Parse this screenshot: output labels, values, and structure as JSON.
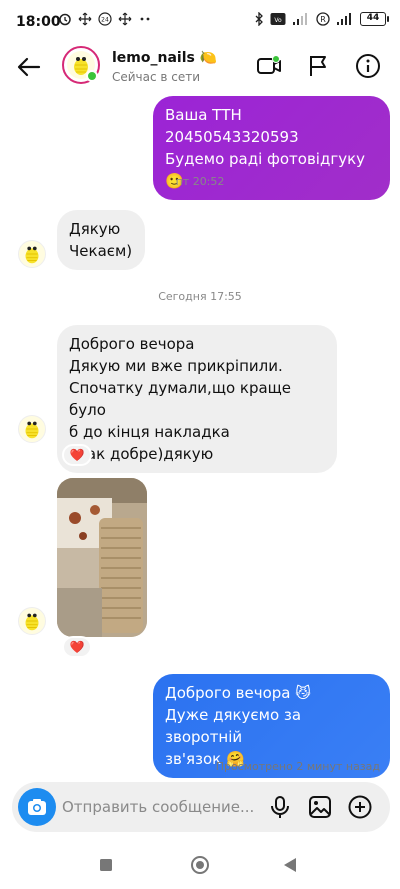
{
  "status_bar": {
    "time": "18:00",
    "network": "LTE",
    "battery": "44"
  },
  "header": {
    "username": "lemo_nails",
    "username_emoji": "🍋",
    "status": "Сейчас в сети",
    "icons": [
      "back-arrow-icon",
      "video-call-icon",
      "flag-icon",
      "info-icon"
    ]
  },
  "messages": [
    {
      "id": "m1",
      "direction": "outgoing",
      "text": "Ваша ТТН 20450543320593\nБудемо раді фотовідгуку 🙂"
    },
    {
      "id": "t1",
      "type": "timestamp",
      "text": "пт 20:52"
    },
    {
      "id": "m2",
      "direction": "incoming",
      "text": "Дякую\nЧекаєм)"
    },
    {
      "id": "t2",
      "type": "timestamp",
      "text": "Сегодня 17:55"
    },
    {
      "id": "m3",
      "direction": "incoming",
      "text": "Доброго вечора\nДякую ми вже прикріпили.\nСпочатку думали,що краще було\nб до кінця накладка\nІ так добре)дякую",
      "reaction": "❤️"
    },
    {
      "id": "m4",
      "direction": "incoming",
      "type": "photo",
      "reaction": "❤️"
    },
    {
      "id": "m5",
      "direction": "outgoing",
      "text": "Доброго вечора 😼\nДуже дякуємо за зворотній\nзв'язок 🤗"
    }
  ],
  "seen_text": "Просмотрено 2 минут назад",
  "composer": {
    "placeholder": "Отправить сообщение..."
  },
  "colors": {
    "outgoing_purple": "#9b24d6",
    "outgoing_blue": "#2b72f0",
    "incoming_bg": "#efefef",
    "camera_button": "#1d8cf0",
    "online": "#3bc43b"
  }
}
